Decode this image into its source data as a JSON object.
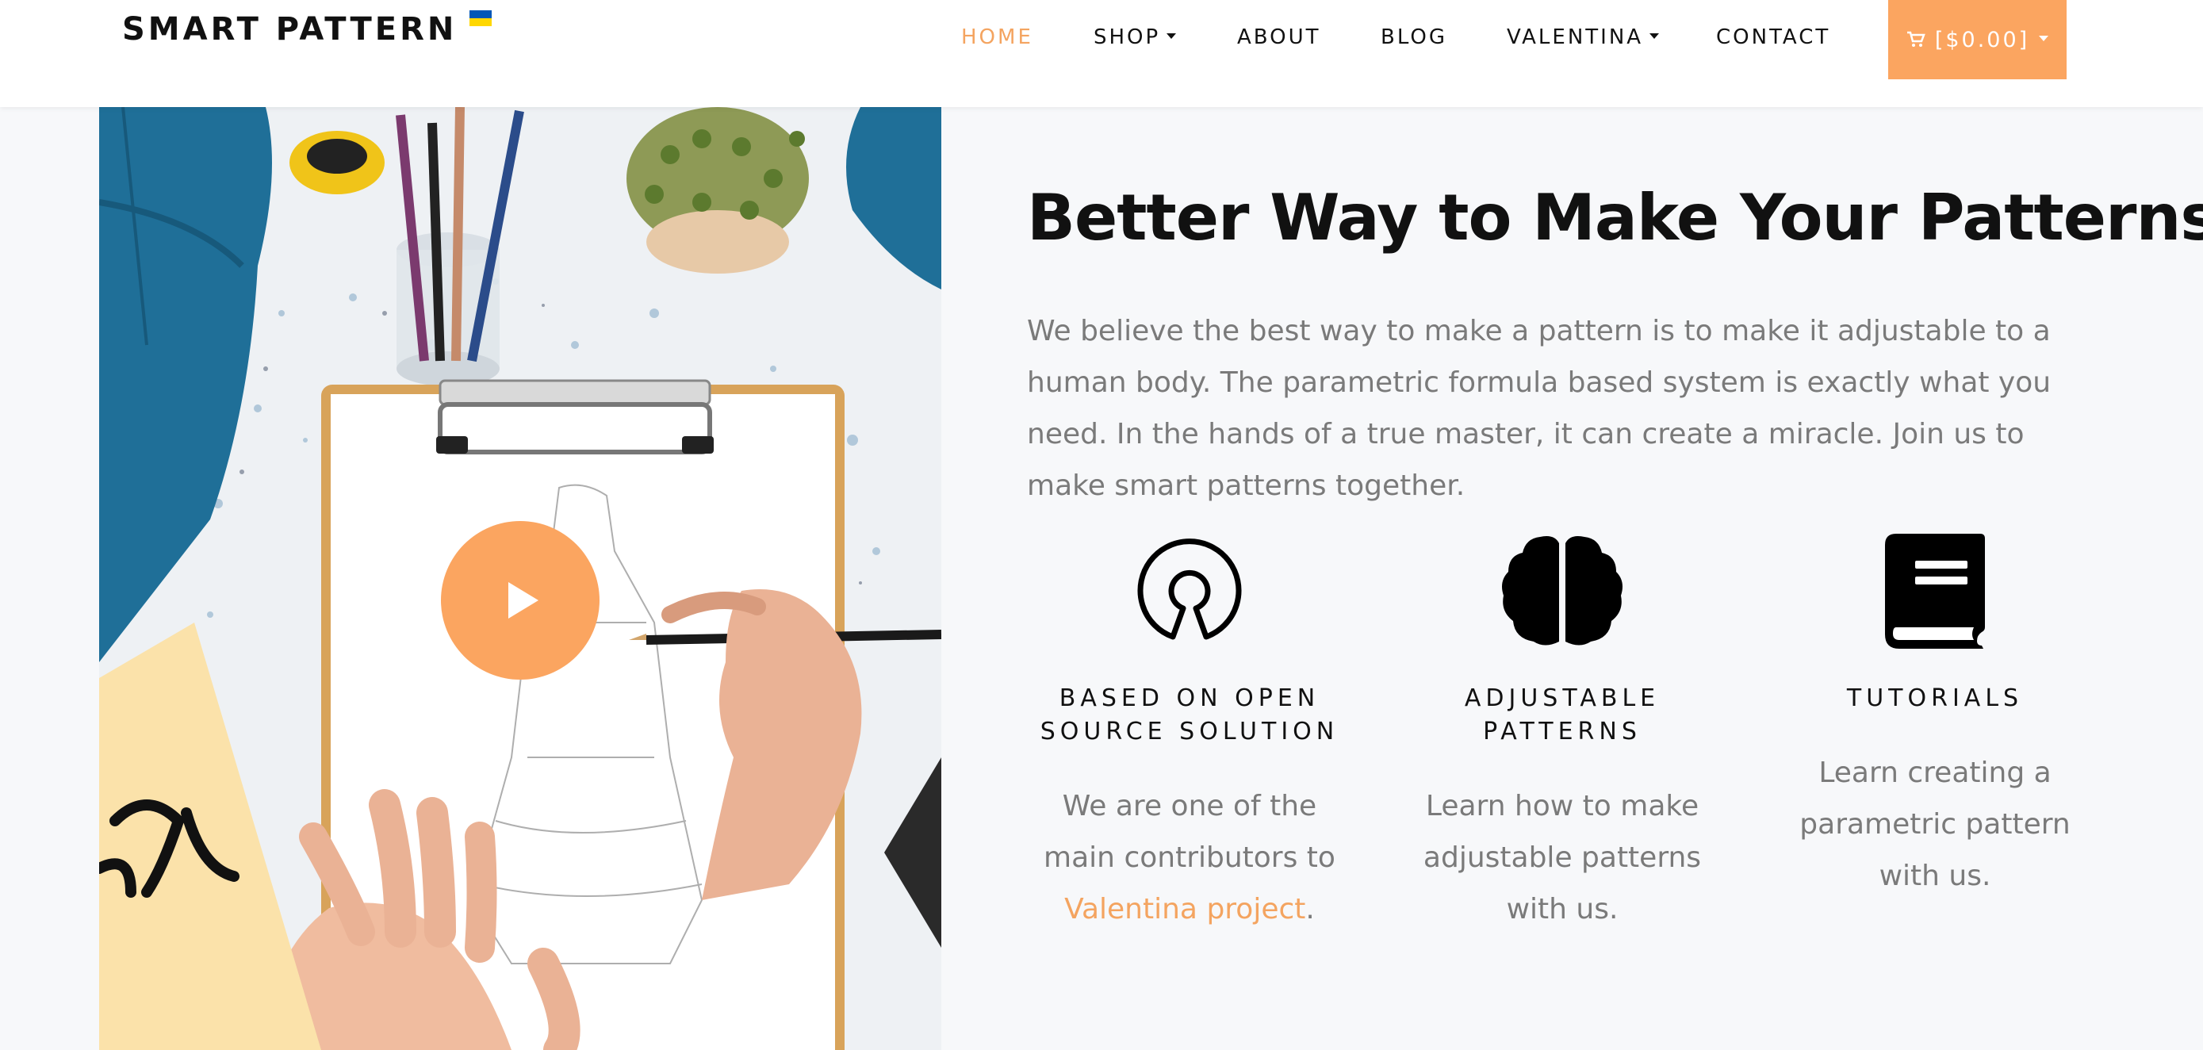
{
  "header": {
    "logo_text": "SMART PATTERN",
    "flag_colors": [
      "#0057b7",
      "#ffd700"
    ],
    "nav": [
      {
        "label": "HOME",
        "active": true
      },
      {
        "label": "SHOP",
        "dropdown": true
      },
      {
        "label": "ABOUT"
      },
      {
        "label": "BLOG"
      },
      {
        "label": "VALENTINA",
        "dropdown": true
      },
      {
        "label": "CONTACT"
      }
    ],
    "cart_label": "[$0.00]",
    "cart_icon": "cart-icon"
  },
  "hero": {
    "play_icon": "play-icon",
    "headline": "Better Way to Make Your Patterns",
    "intro": "We believe the best way to make a pattern is to make it adjustable to a human body. The parametric formula based system is exactly what you need. In the hands of a true master, it can create a miracle. Join us to make smart patterns together."
  },
  "features": [
    {
      "icon": "open-source-icon",
      "title_line1": "BASED ON OPEN",
      "title_line2": "SOURCE SOLUTION",
      "text_before_link": "We are one of the main contributors to ",
      "link_text": "Valentina project",
      "text_after_link": "."
    },
    {
      "icon": "brain-icon",
      "title_line1": "ADJUSTABLE",
      "title_line2": "PATTERNS",
      "text": "Learn how to make adjustable patterns with us."
    },
    {
      "icon": "book-icon",
      "title_line1": "TUTORIALS",
      "text": "Learn creating a parametric pattern with us."
    }
  ],
  "colors": {
    "accent": "#fba560",
    "accent_text": "#f4a460",
    "body_text": "#7a7a7a",
    "heading": "#111111",
    "page_bg": "#f7f8fa"
  }
}
